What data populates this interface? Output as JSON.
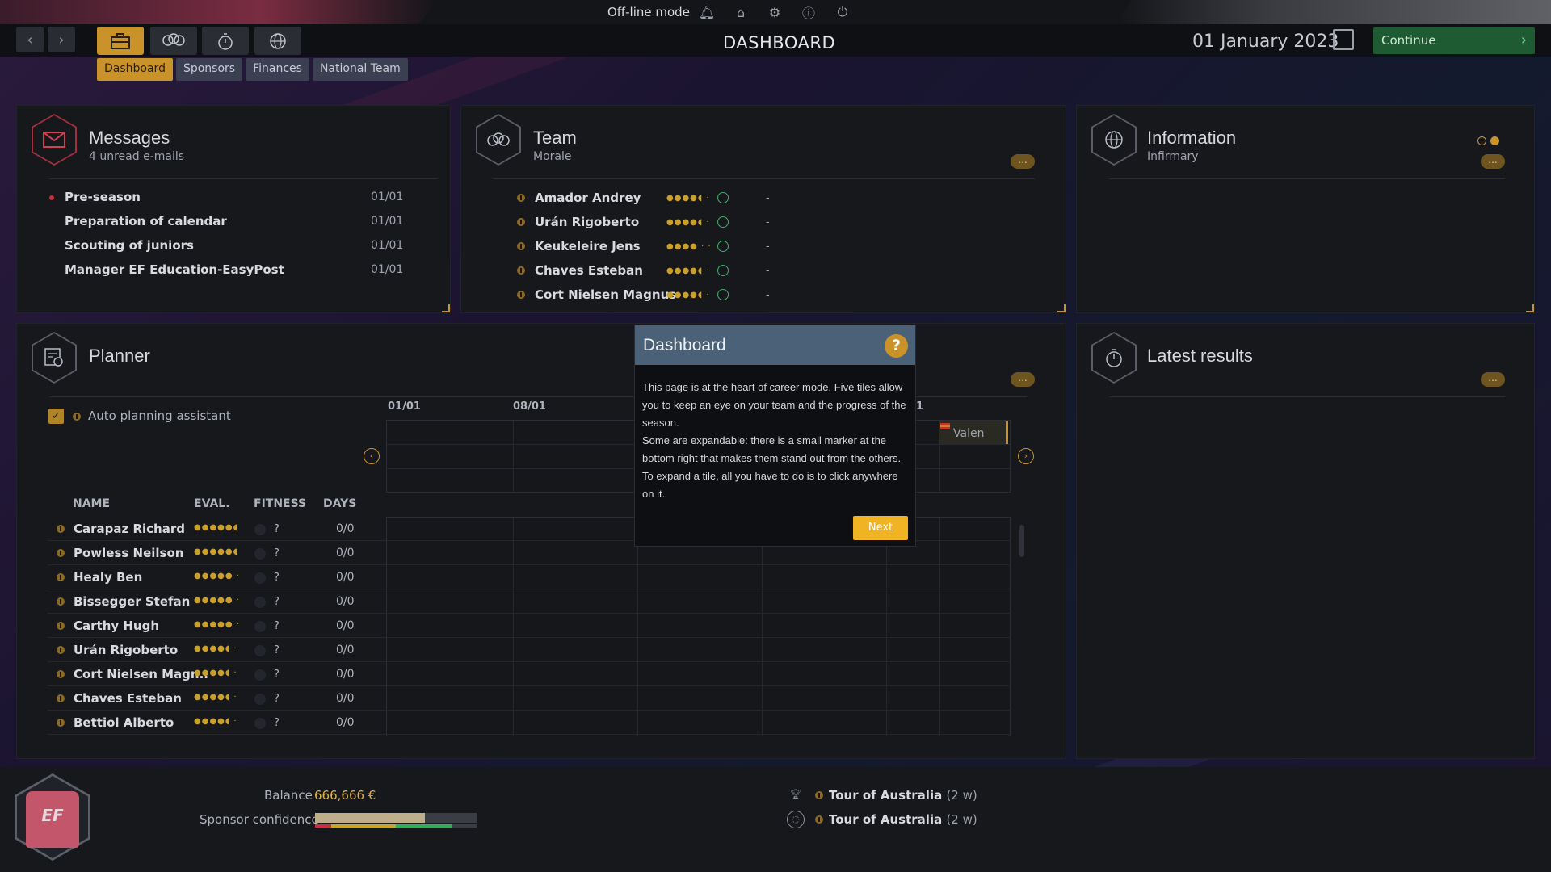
{
  "topbar": {
    "mode_label": "Off-line mode",
    "icons": [
      "bell-icon",
      "home-icon",
      "gear-icon",
      "info-icon",
      "power-icon"
    ]
  },
  "header": {
    "title": "DASHBOARD",
    "date": "01 January 2023",
    "continue_label": "Continue",
    "mode_icons": [
      "briefcase-icon",
      "team-icon",
      "stopwatch-icon",
      "globe-icon"
    ]
  },
  "subtabs": [
    "Dashboard",
    "Sponsors",
    "Finances",
    "National Team"
  ],
  "messages": {
    "title": "Messages",
    "subtitle": "4 unread e-mails",
    "items": [
      {
        "label": "Pre-season",
        "date": "01/01"
      },
      {
        "label": "Preparation of calendar",
        "date": "01/01"
      },
      {
        "label": "Scouting of juniors",
        "date": "01/01"
      },
      {
        "label": "Manager EF Education-EasyPost",
        "date": "01/01"
      }
    ]
  },
  "team": {
    "title": "Team",
    "subtitle": "Morale",
    "more_label": "...",
    "riders": [
      {
        "name": "Amador Andrey",
        "stars": "●●●●◖ ·",
        "value": "-"
      },
      {
        "name": "Urán Rigoberto",
        "stars": "●●●●◖ ·",
        "value": "-"
      },
      {
        "name": "Keukeleire Jens",
        "stars": "●●●● · ·",
        "value": "-"
      },
      {
        "name": "Chaves Esteban",
        "stars": "●●●●◖ ·",
        "value": "-"
      },
      {
        "name": "Cort Nielsen Magnus",
        "stars": "●●●●◖ ·",
        "value": "-"
      }
    ]
  },
  "information": {
    "title": "Information",
    "subtitle": "Infirmary",
    "more_label": "..."
  },
  "planner": {
    "title": "Planner",
    "more_label": "...",
    "auto_label": "Auto planning assistant",
    "dates": [
      "01/01",
      "08/01",
      "1"
    ],
    "race_label": "Valen",
    "columns": [
      "NAME",
      "EVAL.",
      "FITNESS",
      "DAYS"
    ],
    "riders": [
      {
        "name": "Carapaz Richard",
        "stars": "●●●●●◖",
        "fitness": "?",
        "days": "0/0"
      },
      {
        "name": "Powless Neilson",
        "stars": "●●●●●◖",
        "fitness": "?",
        "days": "0/0"
      },
      {
        "name": "Healy Ben",
        "stars": "●●●●● ·",
        "fitness": "?",
        "days": "0/0"
      },
      {
        "name": "Bissegger Stefan",
        "stars": "●●●●● ·",
        "fitness": "?",
        "days": "0/0"
      },
      {
        "name": "Carthy Hugh",
        "stars": "●●●●● ·",
        "fitness": "?",
        "days": "0/0"
      },
      {
        "name": "Urán Rigoberto",
        "stars": "●●●●◖ ·",
        "fitness": "?",
        "days": "0/0"
      },
      {
        "name": "Cort Nielsen Magn..",
        "stars": "●●●●◖ ·",
        "fitness": "?",
        "days": "0/0"
      },
      {
        "name": "Chaves Esteban",
        "stars": "●●●●◖ ·",
        "fitness": "?",
        "days": "0/0"
      },
      {
        "name": "Bettiol Alberto",
        "stars": "●●●●◖ ·",
        "fitness": "?",
        "days": "0/0"
      }
    ]
  },
  "latest_results": {
    "title": "Latest results",
    "more_label": "..."
  },
  "modal": {
    "title": "Dashboard",
    "help": "?",
    "body": [
      "This page is at the heart of career mode. Five tiles allow you to keep an eye on your team and the progress of the season.",
      "Some are expandable: there is a small marker at the bottom right that makes them stand out from the others. To expand a tile, all you have to do is to click anywhere on it."
    ],
    "next_label": "Next"
  },
  "bottom": {
    "jersey_text": "EF",
    "balance_label": "Balance",
    "balance_value": "666,666 €",
    "confidence_label": "Sponsor confidence",
    "confidence_fraction": 0.68,
    "results": [
      {
        "race": "Tour of Australia",
        "when": "(2 w)"
      },
      {
        "race": "Tour of Australia",
        "when": "(2 w)"
      }
    ]
  },
  "colors": {
    "accent": "#c9932a",
    "continue": "#1e5a32",
    "modal_header": "#4b6177",
    "messages_red": "#c5303f"
  }
}
